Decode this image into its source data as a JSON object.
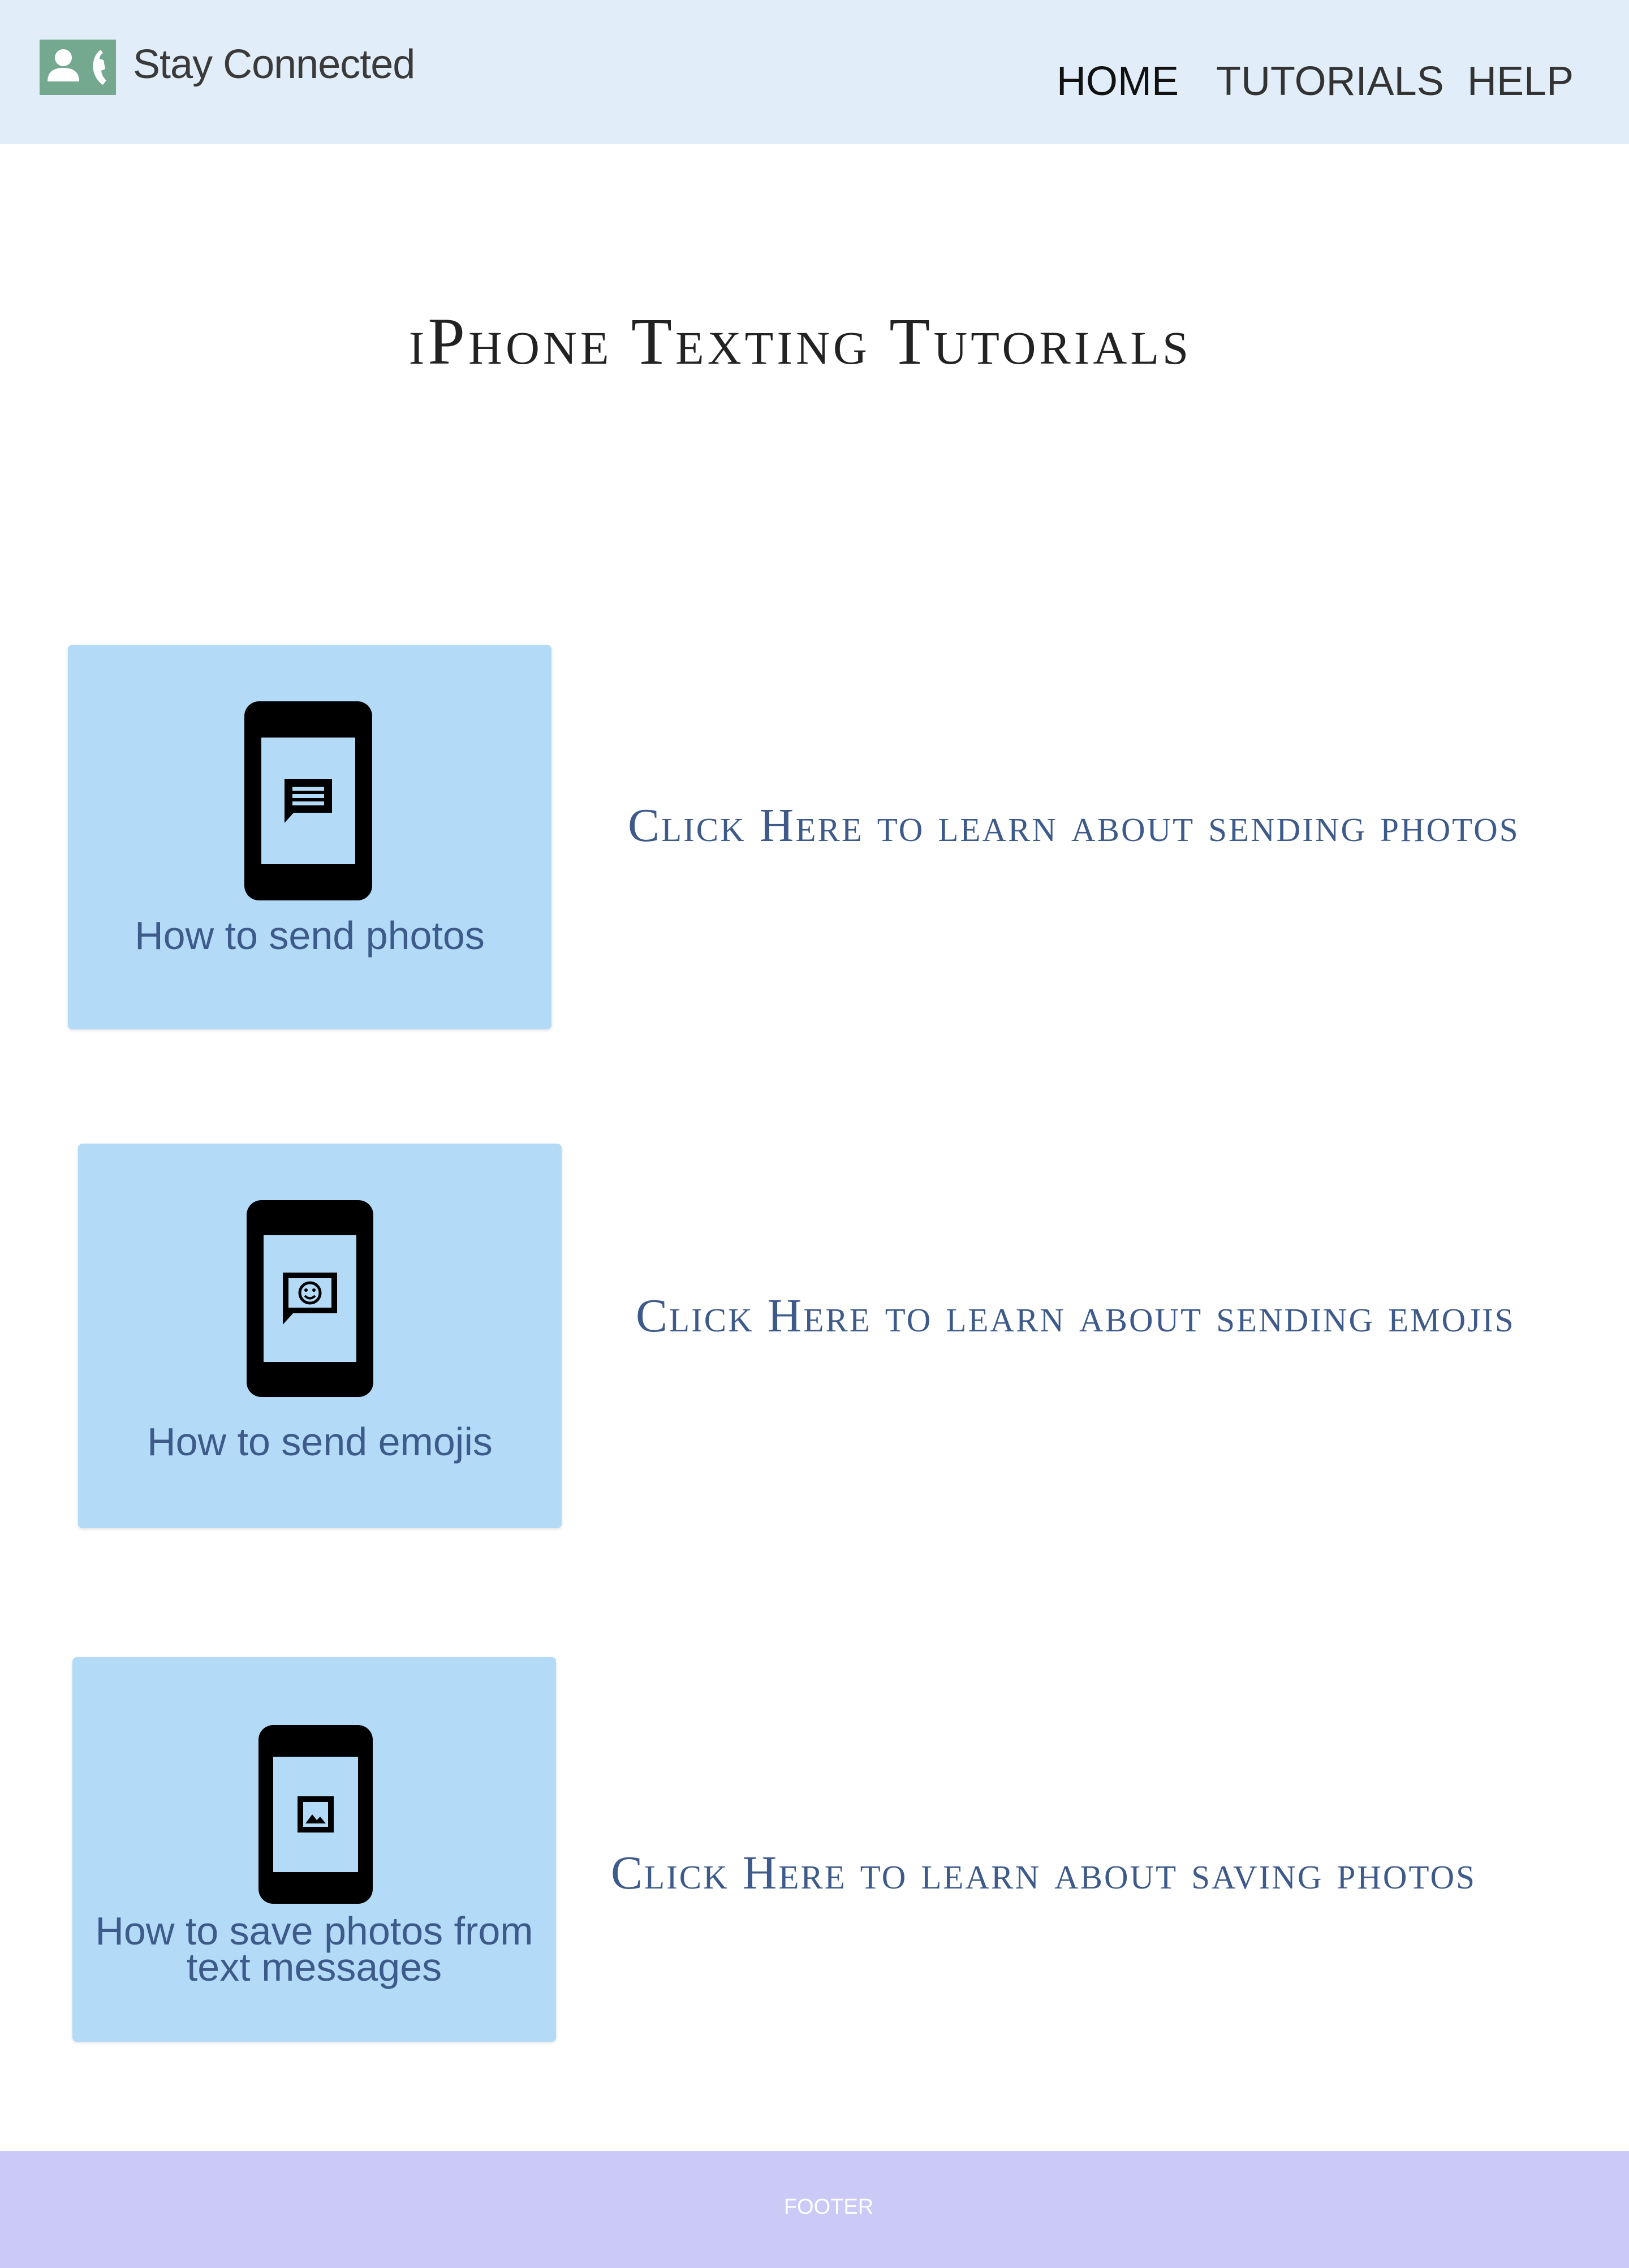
{
  "header": {
    "brand": "Stay Connected",
    "logo_icon": "contact-phone-icon",
    "nav": [
      {
        "label": "HOME"
      },
      {
        "label": "TUTORIALS"
      },
      {
        "label": "HELP"
      }
    ],
    "background_color": "#e1edf8",
    "logo_color": "#74a88f"
  },
  "main": {
    "title": "iPhone Texting Tutorials",
    "tutorials": [
      {
        "card_label": "How to send photos",
        "icon": "phone-message-icon",
        "link_text": "Click Here to learn about sending photos"
      },
      {
        "card_label": "How to send emojis",
        "icon": "phone-emoji-message-icon",
        "link_text": "Click Here to learn about sending emojis"
      },
      {
        "card_label": "How to save photos from text messages",
        "icon": "phone-image-icon",
        "link_text": "Click Here to learn about saving photos"
      }
    ],
    "card_color": "#b3dbf7",
    "link_color": "#3d5a8a"
  },
  "footer": {
    "text": "FOOTER",
    "background_color": "#cbc9f5"
  }
}
